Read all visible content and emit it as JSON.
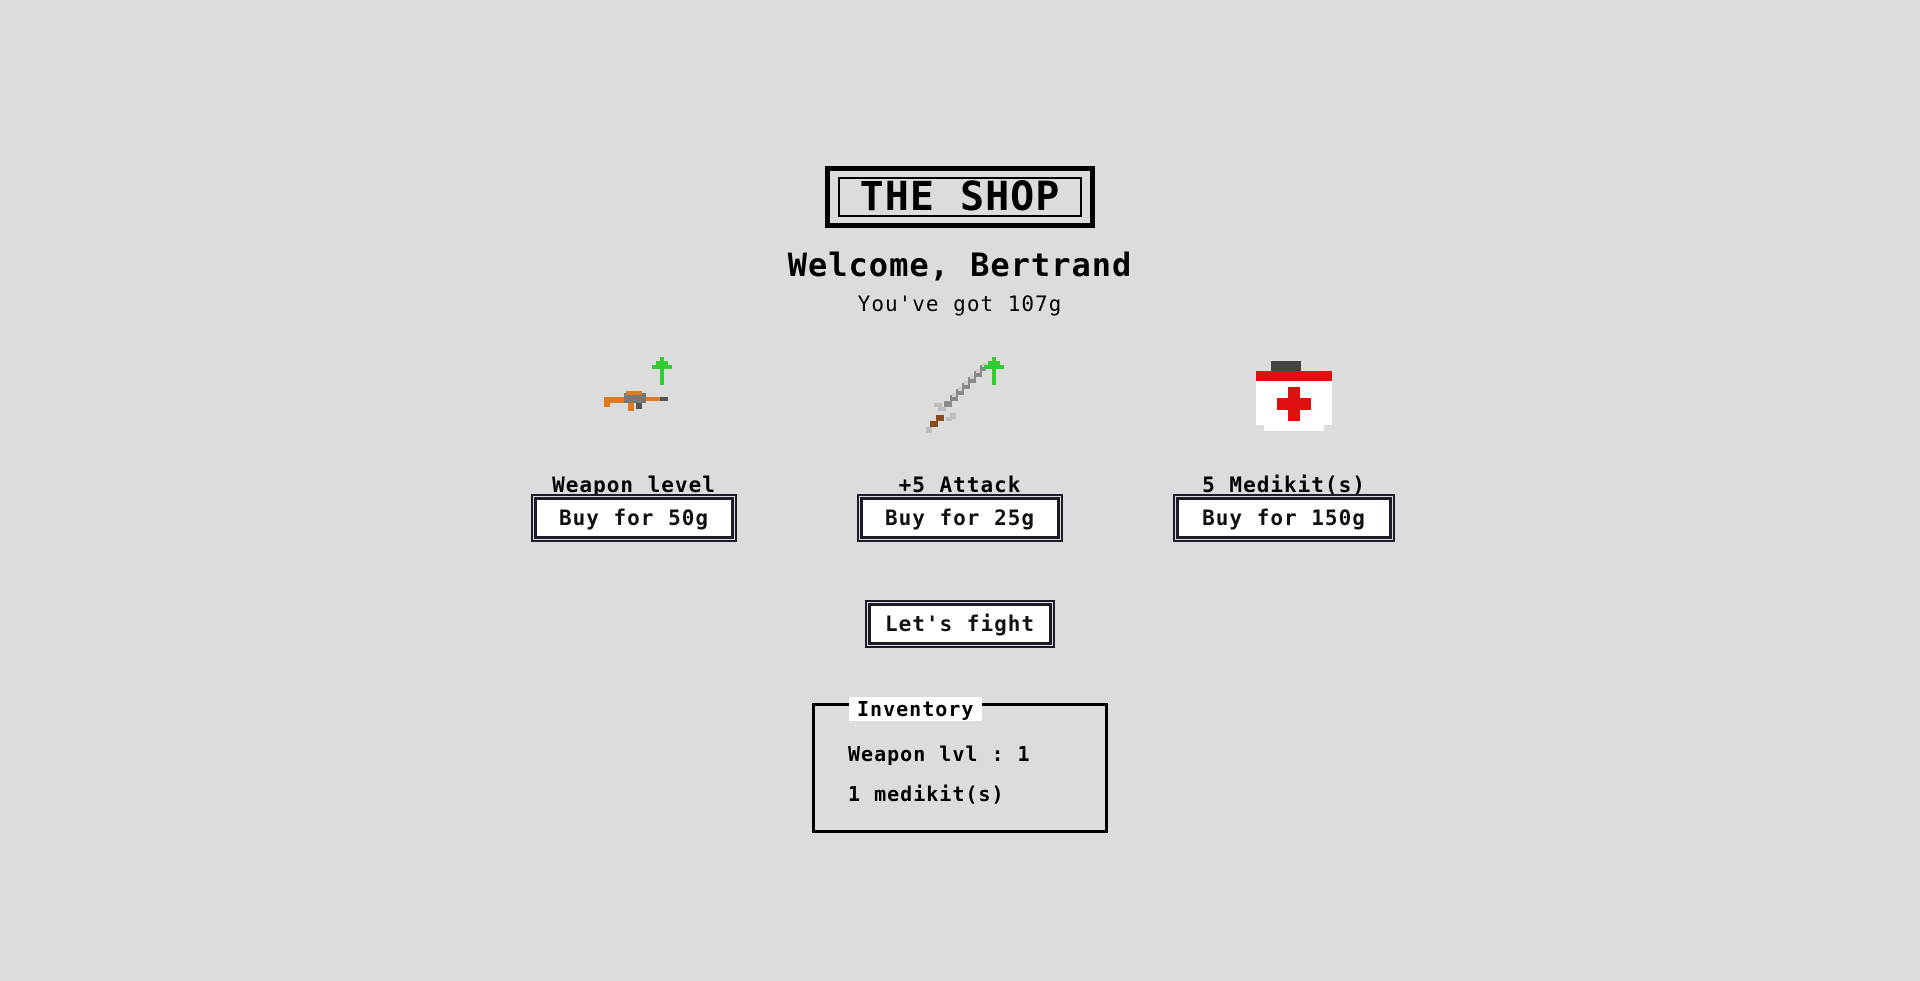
{
  "header": {
    "title": "THE SHOP",
    "welcome": "Welcome, Bertrand",
    "gold": "You've got 107g"
  },
  "shop": {
    "items": [
      {
        "icon": "rifle-upgrade-icon",
        "label": "Weapon level",
        "button": "Buy for 50g"
      },
      {
        "icon": "sword-upgrade-icon",
        "label": "+5 Attack",
        "button": "Buy for 25g"
      },
      {
        "icon": "medikit-icon",
        "label": "5 Medikit(s)",
        "button": "Buy for 150g"
      }
    ]
  },
  "actions": {
    "fight": "Let's fight"
  },
  "inventory": {
    "legend": "Inventory",
    "lines": [
      "Weapon lvl : 1",
      "1 medikit(s)"
    ]
  },
  "colors": {
    "background": "#dcdcdc",
    "upgrade_arrow": "#33cc33",
    "medikit_red": "#e01010"
  }
}
